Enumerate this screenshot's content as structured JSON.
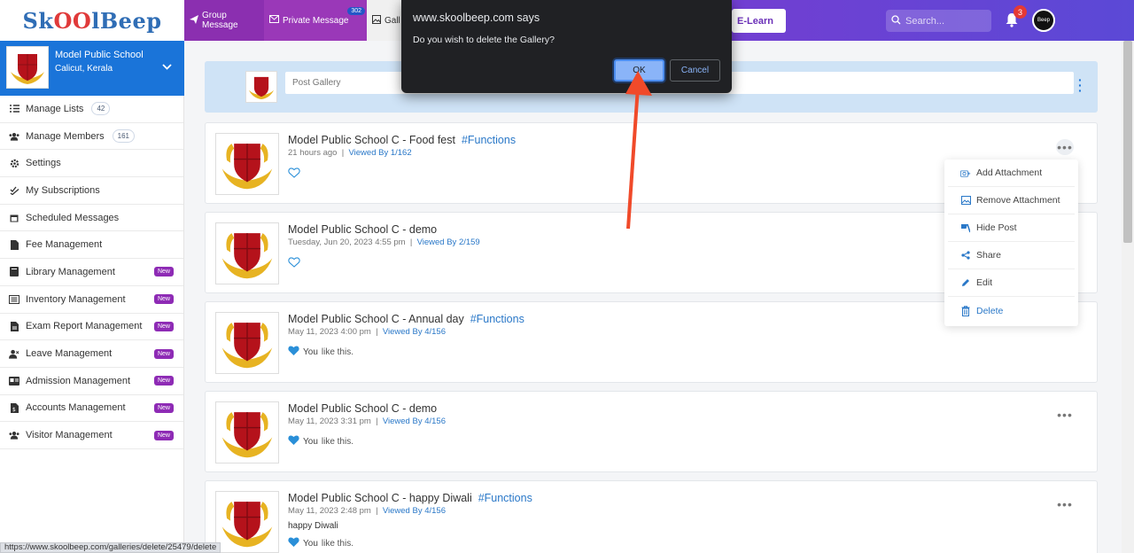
{
  "logo": {
    "part1": "Sk",
    "part2": "OO",
    "part3": "lBeep"
  },
  "tabs": {
    "group_message": "Group Message",
    "private_message": "Private Message",
    "private_count": "302",
    "gallery": "Gall"
  },
  "elearn_label": "E-Learn",
  "search": {
    "placeholder": "Search..."
  },
  "notifications_count": "3",
  "avatar_text": "Beep",
  "school": {
    "name": "Model Public School",
    "location": "Calicut, Kerala"
  },
  "sidebar": {
    "items": [
      {
        "label": "Manage Lists",
        "count": "42",
        "icon": "list-icon"
      },
      {
        "label": "Manage Members",
        "count": "161",
        "icon": "users-icon"
      },
      {
        "label": "Settings",
        "icon": "gear-icon"
      },
      {
        "label": "My Subscriptions",
        "icon": "check-icon"
      },
      {
        "label": "Scheduled Messages",
        "icon": "calendar-icon"
      },
      {
        "label": "Fee Management",
        "icon": "file-icon"
      },
      {
        "label": "Library Management",
        "badge": "New",
        "icon": "book-icon"
      },
      {
        "label": "Inventory Management",
        "badge": "New",
        "icon": "inventory-icon"
      },
      {
        "label": "Exam Report Management",
        "badge": "New",
        "icon": "report-icon"
      },
      {
        "label": "Leave Management",
        "badge": "New",
        "icon": "user-leave-icon"
      },
      {
        "label": "Admission Management",
        "badge": "New",
        "icon": "admission-icon"
      },
      {
        "label": "Accounts Management",
        "badge": "New",
        "icon": "accounts-icon"
      },
      {
        "label": "Visitor Management",
        "badge": "New",
        "icon": "visitors-icon"
      }
    ]
  },
  "post_gallery": {
    "placeholder": "Post Gallery"
  },
  "posts": [
    {
      "title": "Model Public School C - Food fest",
      "tag": "#Functions",
      "time": "21 hours ago",
      "viewed": "Viewed By 1/162",
      "body": "",
      "liked": false,
      "like_text": ""
    },
    {
      "title": "Model Public School C - demo",
      "tag": "",
      "time": "Tuesday, Jun 20, 2023 4:55 pm",
      "viewed": "Viewed By 2/159",
      "body": "",
      "liked": false,
      "like_text": ""
    },
    {
      "title": "Model Public School C - Annual day",
      "tag": "#Functions",
      "time": "May 11, 2023 4:00 pm",
      "viewed": "Viewed By 4/156",
      "body": "",
      "liked": true,
      "like_you": "You",
      "like_text": "like this."
    },
    {
      "title": "Model Public School C - demo",
      "tag": "",
      "time": "May 11, 2023 3:31 pm",
      "viewed": "Viewed By 4/156",
      "body": "",
      "liked": true,
      "like_you": "You",
      "like_text": "like this."
    },
    {
      "title": "Model Public School C - happy Diwali",
      "tag": "#Functions",
      "time": "May 11, 2023 2:48 pm",
      "viewed": "Viewed By 4/156",
      "body": "happy Diwali",
      "liked": true,
      "like_you": "You",
      "like_text": "like this."
    }
  ],
  "dropdown": {
    "items": [
      {
        "label": "Add Attachment",
        "icon": "camera-icon"
      },
      {
        "label": "Remove Attachment",
        "icon": "image-icon"
      },
      {
        "label": "Hide Post",
        "icon": "hide-icon"
      },
      {
        "label": "Share",
        "icon": "share-icon"
      },
      {
        "label": "Edit",
        "icon": "pencil-icon"
      },
      {
        "label": "Delete",
        "icon": "trash-icon"
      }
    ]
  },
  "dialog": {
    "title": "www.skoolbeep.com says",
    "message": "Do you wish to delete the Gallery?",
    "ok": "OK",
    "cancel": "Cancel"
  },
  "status_url": "https://www.skoolbeep.com/galleries/delete/25479/delete",
  "colors": {
    "brand_purple": "#6a2fb8",
    "sidebar_blue": "#1a74d9",
    "tag_blue": "#2a78c8",
    "new_badge": "#8e2bb5",
    "arrow_red": "#f04a2a"
  }
}
